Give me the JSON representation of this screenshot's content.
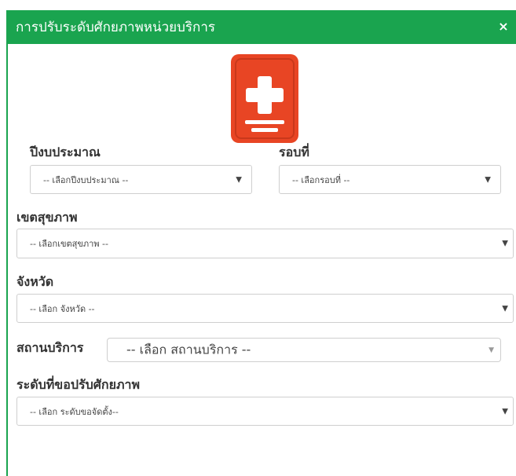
{
  "modal": {
    "title": "การปรับระดับศักยภาพหน่วยบริการ",
    "close_icon": "close-icon",
    "close_symbol": "×",
    "logo_icon": "medical-book-icon",
    "colors": {
      "header": "#1aa44f",
      "logo": "#e84524"
    }
  },
  "form": {
    "budget_year": {
      "label": "ปีงบประมาณ",
      "value": "-- เลือกปีงบประมาณ --"
    },
    "round": {
      "label": "รอบที่",
      "value": "-- เลือกรอบที่ --"
    },
    "health_region": {
      "label": "เขตสุขภาพ",
      "value": "-- เลือกเขตสุขภาพ --"
    },
    "province": {
      "label": "จังหวัด",
      "value": "-- เลือก จังหวัด --"
    },
    "service_unit": {
      "label": "สถานบริการ",
      "value": "-- เลือก สถานบริการ --"
    },
    "requested_level": {
      "label": "ระดับที่ขอปรับศักยภาพ",
      "value": "-- เลือก ระดับขอจัดตั้ง--"
    },
    "dropdown_arrow": "▼"
  }
}
